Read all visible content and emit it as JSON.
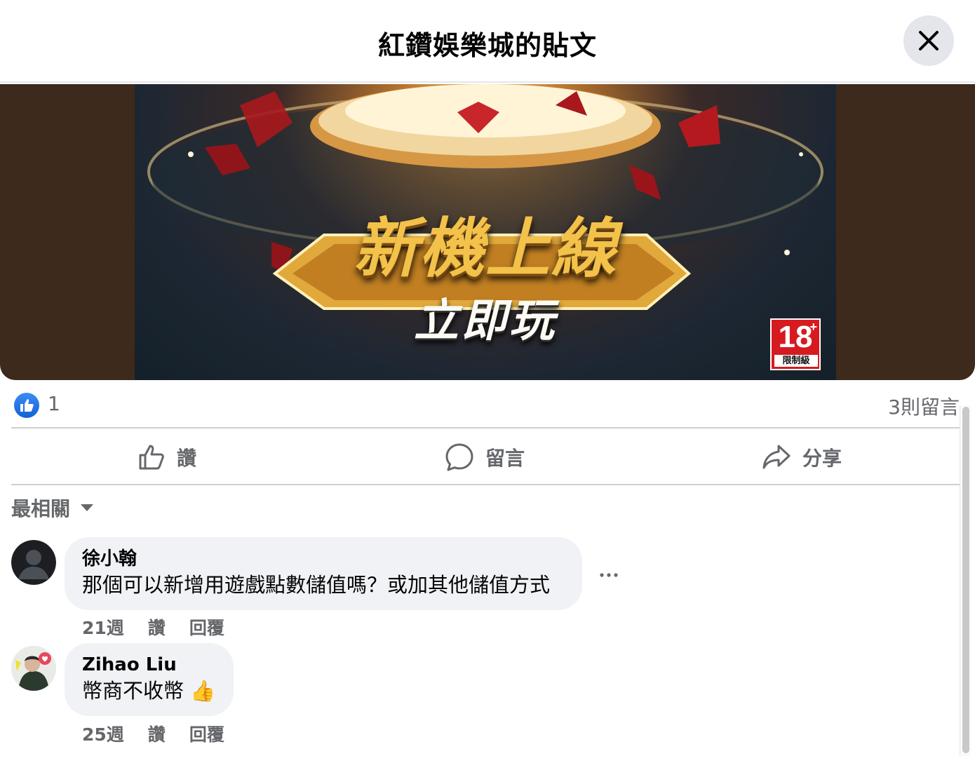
{
  "dialog": {
    "title": "紅鑽娛樂城的貼文",
    "close_icon": "close-icon"
  },
  "post_image": {
    "headline": "新機上線",
    "subline": "立即玩",
    "rating_number": "18",
    "rating_plus": "+",
    "rating_label": "限制級",
    "colors": {
      "gold": "#f2c24a",
      "backdrop": "#3d2a1c",
      "badge": "#d71920"
    }
  },
  "stats": {
    "like_count": "1",
    "comment_count": "3則留言"
  },
  "actions": {
    "like_label": "讚",
    "comment_label": "留言",
    "share_label": "分享"
  },
  "sort": {
    "label": "最相關"
  },
  "comments": [
    {
      "author": "徐小翰",
      "text": "那個可以新增用遊戲點數儲值嗎？或加其他儲值方式",
      "time": "21週",
      "like_label": "讚",
      "reply_label": "回覆"
    },
    {
      "author": "Zihao Liu",
      "text": "幣商不收幣 👍",
      "time": "25週",
      "like_label": "讚",
      "reply_label": "回覆"
    }
  ],
  "colors": {
    "text_secondary": "#65676b",
    "bubble_bg": "#f0f2f5",
    "like_blue": "#1877f2"
  }
}
